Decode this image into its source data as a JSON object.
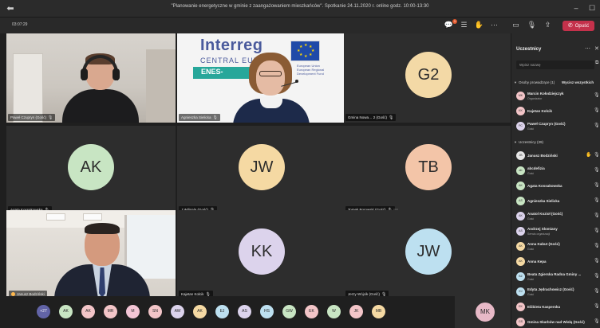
{
  "window": {
    "title": "\"Planowanie energetyczne w gminie z zaangażowaniem mieszkańców\". Spotkanie 24.11.2020 r. online godz. 10:00-13:30",
    "minimize_glyph": "–",
    "maximize_glyph": "☐"
  },
  "toolbar": {
    "timer": "03:07:29",
    "chat_badge": "1",
    "leave_label": "Opuść"
  },
  "tiles": [
    {
      "name": "Paweł Czupryn (Gość)",
      "type": "video"
    },
    {
      "name": "Agnieszka Sielicka",
      "type": "video"
    },
    {
      "name": "Gmina Nowa… 2 (Gość)",
      "initials": "G2",
      "color": "#f3d9a6"
    },
    {
      "name": "Agata Kossakowska",
      "initials": "AK",
      "color": "#c8e5c3"
    },
    {
      "name": "J Wiligala (Gość)",
      "initials": "JW",
      "color": "#f5d9a3"
    },
    {
      "name": "Tomek Borowski (Gość)",
      "initials": "TB",
      "color": "#f3c5a8"
    },
    {
      "name": "Janusz Bodziński",
      "type": "video"
    },
    {
      "name": "Kajetan Kolcik",
      "initials": "KK",
      "color": "#dcd3ec"
    },
    {
      "name": "Jerzy Wójcik (Gość)",
      "initials": "JW",
      "color": "#bde0f0"
    }
  ],
  "banner": {
    "interreg": "Interreg",
    "central": "CENTRAL EUROPE",
    "enes": "ENES-",
    "eu_text": "European Union\nEuropean Regional\nDevelopment Fund"
  },
  "strip": {
    "overflow_count": "+27",
    "avatars": [
      {
        "initials": "AK",
        "color": "#c8e5c3"
      },
      {
        "initials": "AK",
        "color": "#f3c5c8"
      },
      {
        "initials": "MR",
        "color": "#f3c5c8"
      },
      {
        "initials": "M",
        "color": "#f3c5d5"
      },
      {
        "initials": "SN",
        "color": "#f3c5c8"
      },
      {
        "initials": "AW",
        "color": "#dcd3ec"
      },
      {
        "initials": "AK",
        "color": "#f5d9a3"
      },
      {
        "initials": "EJ",
        "color": "#bde0f0"
      },
      {
        "initials": "AS",
        "color": "#dcd3ec"
      },
      {
        "initials": "HS",
        "color": "#bde0f0"
      },
      {
        "initials": "GW",
        "color": "#c8e5c3"
      },
      {
        "initials": "EK",
        "color": "#f3c5c8"
      },
      {
        "initials": "W",
        "color": "#c8e5c3"
      },
      {
        "initials": "JK",
        "color": "#f3c5c8"
      },
      {
        "initials": "MB",
        "color": "#f5d9a3"
      }
    ],
    "last_tile_initials": "MK"
  },
  "panel": {
    "title": "Uczestnicy",
    "search_placeholder": "Wpisz nazwę",
    "presenters_header": "Osoby prowadzące (1)",
    "mute_all": "Wycisz wszystkich",
    "attendees_header": "Uczestnicy (39)",
    "presenters": [
      {
        "initials": "MK",
        "name": "Marcin Kołodziejczyk",
        "role": "Organizator",
        "color": "#f3c5c8"
      },
      {
        "initials": "KK",
        "name": "Kajetan Kolcik",
        "role": "",
        "color": "#f3c5c8"
      },
      {
        "initials": "PC",
        "name": "Paweł Czupryn (Gość)",
        "role": "Gość",
        "color": "#dcd3ec"
      }
    ],
    "attendees": [
      {
        "initials": "JB",
        "name": "Janusz Bodziński",
        "role": "",
        "color": "#e6e6e6",
        "hand": true
      },
      {
        "initials": "ab",
        "name": "abcdefizia",
        "role": "Gość",
        "color": "#c8e5c3"
      },
      {
        "initials": "AK",
        "name": "Agata Kossakowska",
        "role": "",
        "color": "#c8e5c3"
      },
      {
        "initials": "AS",
        "name": "Agnieszka Sielicka",
        "role": "",
        "color": "#c8e5c3"
      },
      {
        "initials": "AK",
        "name": "Anatol Kozioł (Gość)",
        "role": "Gość",
        "color": "#dcd3ec"
      },
      {
        "initials": "AS",
        "name": "Andrzej Slomiany",
        "role": "Serwis organizacji",
        "color": "#dcd3ec"
      },
      {
        "initials": "AK",
        "name": "Anna Kabut (Gość)",
        "role": "Gość",
        "color": "#f5d9a3"
      },
      {
        "initials": "AK",
        "name": "Anna Kepa",
        "role": "",
        "color": "#f5d9a3"
      },
      {
        "initials": "BZ",
        "name": "Beata Zgierska Radna Gminy ...",
        "role": "Gość",
        "color": "#bde0f0"
      },
      {
        "initials": "EJ",
        "name": "Edyta Jędrachowicz (Gość)",
        "role": "Gość",
        "color": "#bde0f0"
      },
      {
        "initials": "EK",
        "name": "Elżbieta Kasperska",
        "role": "",
        "color": "#f3c5c8"
      },
      {
        "initials": "GS",
        "name": "Gmina Skarbów nad Wisłą (Gość)",
        "role": "",
        "color": "#f3c5c8"
      }
    ]
  }
}
